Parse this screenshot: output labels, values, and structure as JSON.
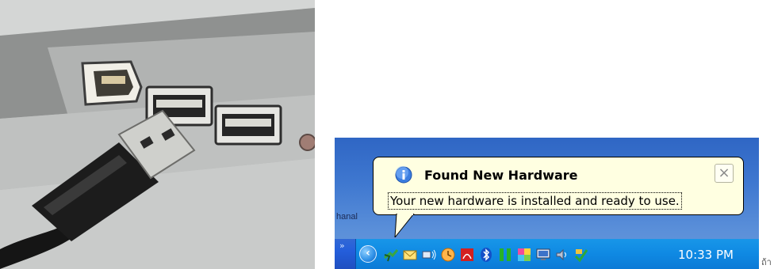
{
  "balloon": {
    "title": "Found New Hardware",
    "message": "Your new hardware is installed and ready to use.",
    "close_symbol": "×"
  },
  "taskbar": {
    "chevron": "»",
    "expand_symbol": "‹",
    "clock": "10:33 PM",
    "tray_icons": [
      "safely-remove-hardware-icon",
      "mail-icon",
      "network-icon",
      "clock-app-icon",
      "acrobat-icon",
      "bluetooth-icon",
      "green-bars-icon",
      "colorful-app-icon",
      "display-icon",
      "speaker-icon",
      "update-icon"
    ]
  },
  "wallpaper": {
    "text": "hanal"
  },
  "caption_fragment": "ถ้า",
  "colors": {
    "balloon_bg": "#ffffe1",
    "taskbar_blue": "#245edb",
    "tray_blue": "#0f89e3"
  }
}
